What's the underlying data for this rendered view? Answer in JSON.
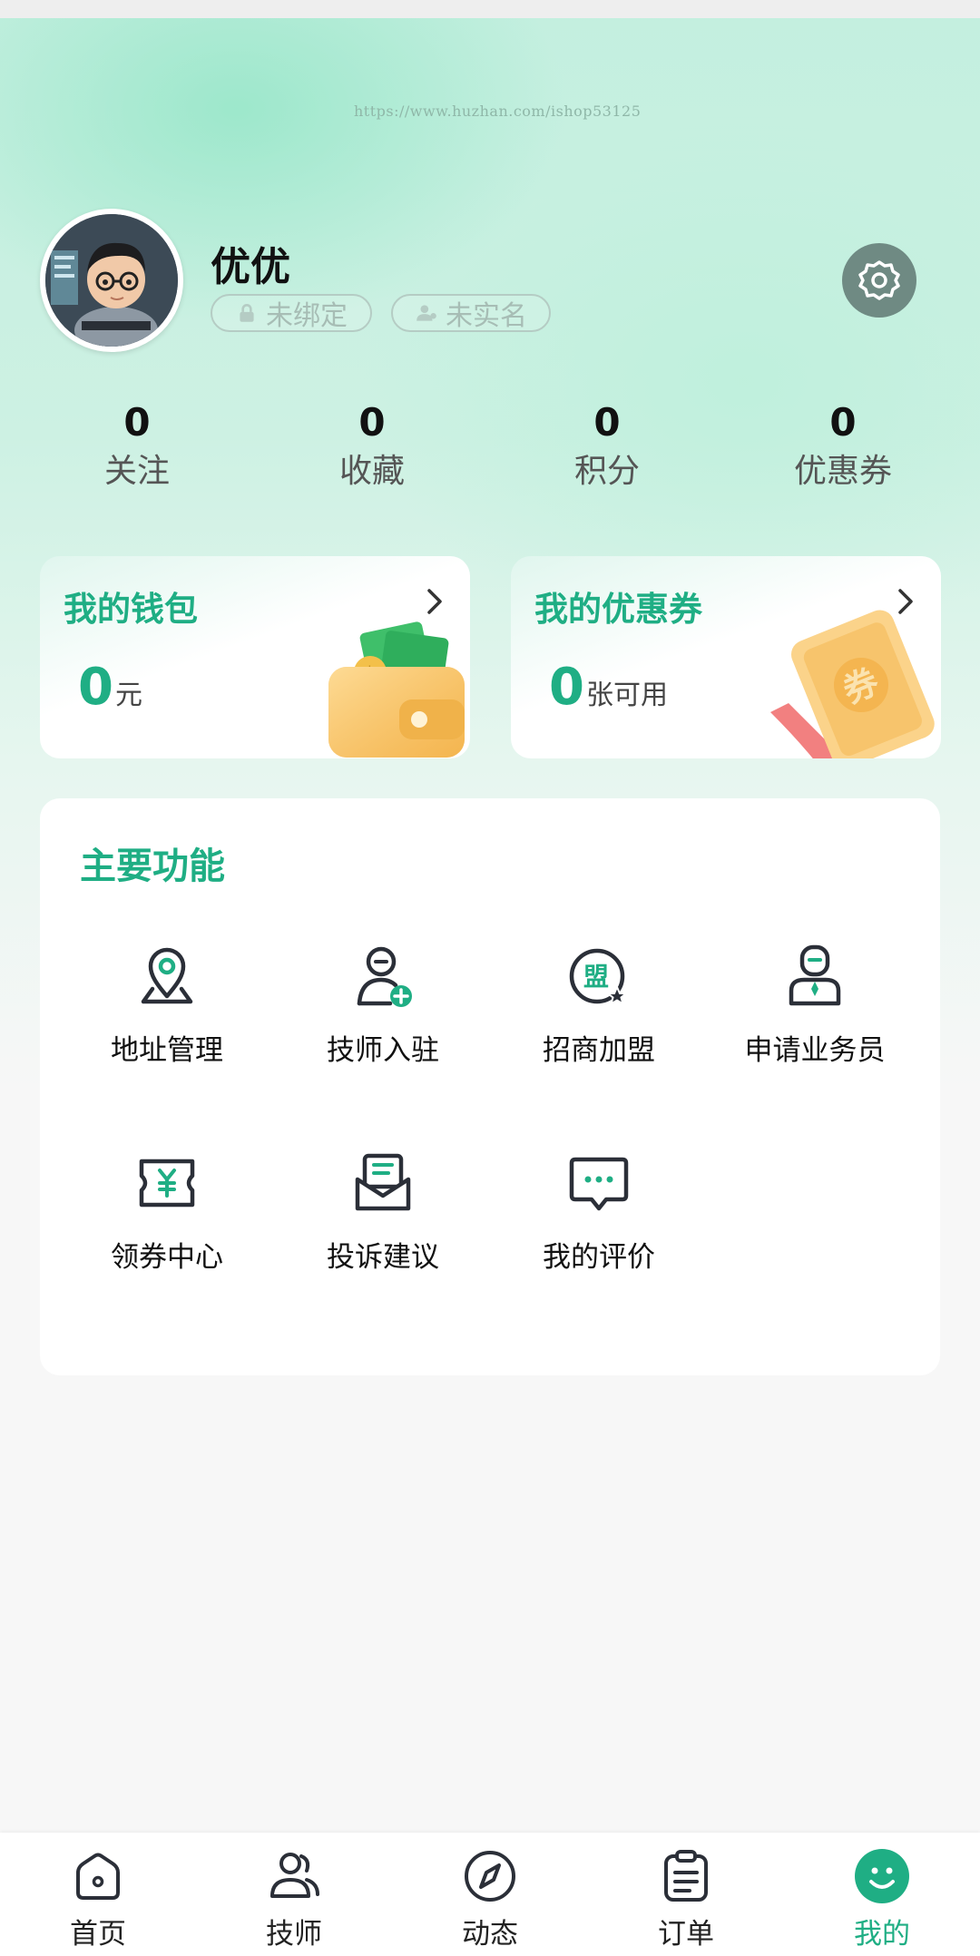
{
  "watermark": "https://www.huzhan.com/ishop53125",
  "profile": {
    "name": "优优",
    "tag_bind": "未绑定",
    "tag_real": "未实名"
  },
  "stats": [
    {
      "value": "0",
      "label": "关注"
    },
    {
      "value": "0",
      "label": "收藏"
    },
    {
      "value": "0",
      "label": "积分"
    },
    {
      "value": "0",
      "label": "优惠券"
    }
  ],
  "wallet": {
    "title": "我的钱包",
    "value": "0",
    "unit": "元"
  },
  "coupon": {
    "title": "我的优惠券",
    "value": "0",
    "unit": "张可用"
  },
  "functions": {
    "title": "主要功能",
    "items": [
      {
        "label": "地址管理",
        "icon": "location-icon"
      },
      {
        "label": "技师入驻",
        "icon": "technician-join-icon"
      },
      {
        "label": "招商加盟",
        "icon": "alliance-icon"
      },
      {
        "label": "申请业务员",
        "icon": "salesman-icon"
      },
      {
        "label": "领券中心",
        "icon": "coupon-center-icon"
      },
      {
        "label": "投诉建议",
        "icon": "complaint-icon"
      },
      {
        "label": "我的评价",
        "icon": "review-icon"
      }
    ]
  },
  "tabbar": {
    "items": [
      {
        "label": "首页",
        "icon": "home-icon"
      },
      {
        "label": "技师",
        "icon": "technician-icon"
      },
      {
        "label": "动态",
        "icon": "compass-icon"
      },
      {
        "label": "订单",
        "icon": "order-icon"
      },
      {
        "label": "我的",
        "icon": "smile-icon",
        "active": true
      }
    ]
  },
  "colors": {
    "accent": "#1fae84",
    "icon_dark": "#2b2f38"
  }
}
